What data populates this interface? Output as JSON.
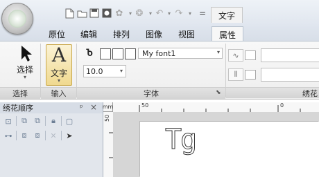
{
  "quick_access": {
    "separator": "=",
    "icons": [
      "new-file-icon",
      "open-file-icon",
      "save-icon",
      "record-icon",
      "embroidery-icon",
      "stitch-icon",
      "undo-icon",
      "redo-icon"
    ]
  },
  "context_tab_title": "文字",
  "tabs": [
    {
      "label": "原位"
    },
    {
      "label": "编辑"
    },
    {
      "label": "排列"
    },
    {
      "label": "图像"
    },
    {
      "label": "视图"
    },
    {
      "label": "属性",
      "active": true
    }
  ],
  "ribbon": {
    "select": {
      "label": "选择",
      "group": "选择"
    },
    "input": {
      "label": "文字",
      "group": "输入"
    },
    "font": {
      "group": "字体",
      "font_name": "My font1",
      "font_size": "10.0"
    },
    "embroidery": {
      "group": "绣花"
    }
  },
  "panel": {
    "title": "绣花顺序",
    "pin": "ᵖ",
    "close": "×"
  },
  "ruler": {
    "unit": "mm",
    "h_labels": [
      "50",
      "0"
    ],
    "v_label": "50"
  },
  "canvas": {
    "outline_text": "Tg"
  },
  "colors": {
    "ribbon_bg": "#f1f1f1",
    "active_button": "#f0d98f",
    "panel_bg": "#e2e6ec"
  }
}
